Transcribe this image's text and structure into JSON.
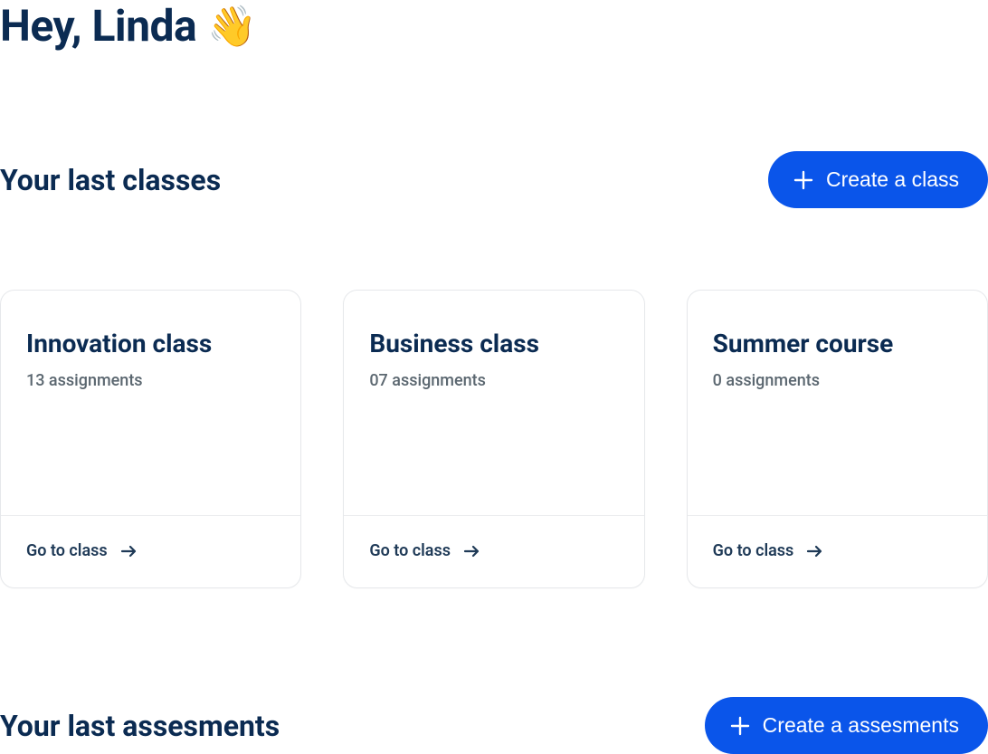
{
  "greeting": {
    "text": "Hey, Linda",
    "emoji": "👋"
  },
  "sections": {
    "classes": {
      "title": "Your last classes",
      "create_label": "Create a class",
      "cards": [
        {
          "title": "Innovation class",
          "subtitle": "13 assignments",
          "cta": "Go to class"
        },
        {
          "title": "Business class",
          "subtitle": "07 assignments",
          "cta": "Go to class"
        },
        {
          "title": "Summer course",
          "subtitle": "0 assignments",
          "cta": "Go to class"
        }
      ]
    },
    "assessments": {
      "title": "Your last assesments",
      "create_label": "Create a assesments"
    }
  },
  "colors": {
    "primary": "#0a55ea",
    "heading": "#0b2b52",
    "muted": "#5b6770"
  }
}
